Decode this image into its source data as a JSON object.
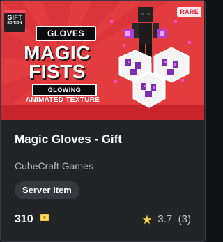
{
  "thumbnail": {
    "gift_badge_line1": "GIFT",
    "gift_badge_line2": "EDITION",
    "rarity": "RARE",
    "gloves_label": "GLOVES",
    "title_line1": "MAGIC",
    "title_line2": "FISTS",
    "glowing_label": "GLOWING",
    "animated_label": "ANIMATED TEXTURE"
  },
  "item": {
    "name": "Magic Gloves - Gift",
    "creator": "CubeCraft Games",
    "type_chip": "Server Item",
    "price": "310",
    "rating": "3.7",
    "rating_count": "(3)"
  },
  "icons": {
    "currency": "minecoin-icon",
    "rating": "star-icon"
  },
  "colors": {
    "card_bg": "#232427",
    "art_red": "#e23c3f",
    "rare_text": "#d7263d",
    "coin": "#f2c233",
    "star": "#f3d64a",
    "glow_purple": "#a43cd6"
  }
}
